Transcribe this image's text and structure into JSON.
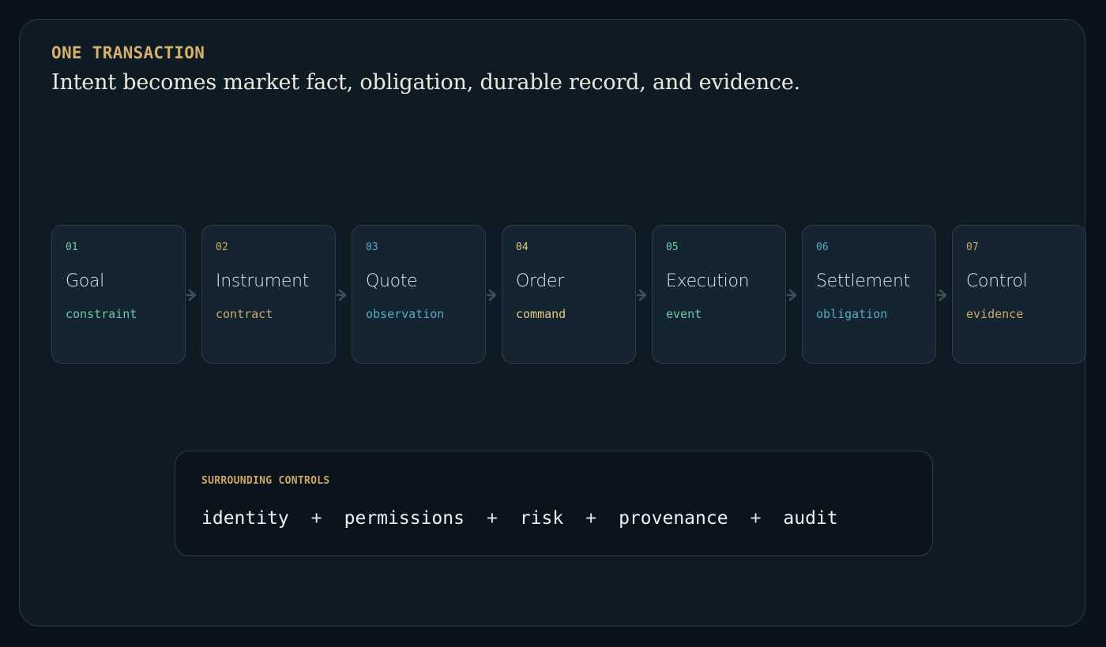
{
  "header": {
    "eyebrow": "ONE TRANSACTION",
    "headline": "Intent becomes market fact, obligation, durable record, and evidence."
  },
  "steps": [
    {
      "num": "01",
      "title": "Goal",
      "kind": "constraint",
      "color": "#6ccaa6"
    },
    {
      "num": "02",
      "title": "Instrument",
      "kind": "contract",
      "color": "#cfa764"
    },
    {
      "num": "03",
      "title": "Quote",
      "kind": "observation",
      "color": "#5aa8c0"
    },
    {
      "num": "04",
      "title": "Order",
      "kind": "command",
      "color": "#e5c97c"
    },
    {
      "num": "05",
      "title": "Execution",
      "kind": "event",
      "color": "#6ccaa6"
    },
    {
      "num": "06",
      "title": "Settlement",
      "kind": "obligation",
      "color": "#5aa8c0"
    },
    {
      "num": "07",
      "title": "Control",
      "kind": "evidence",
      "color": "#cfa764"
    }
  ],
  "controls": {
    "label": "SURROUNDING CONTROLS",
    "items": [
      "identity",
      "permissions",
      "risk",
      "provenance",
      "audit"
    ],
    "separator": "+"
  },
  "colors": {
    "accent_gold": "#d4b069",
    "accent_green": "#6ccaa6",
    "accent_blue": "#5aa8c0",
    "background": "#0f1b24"
  }
}
